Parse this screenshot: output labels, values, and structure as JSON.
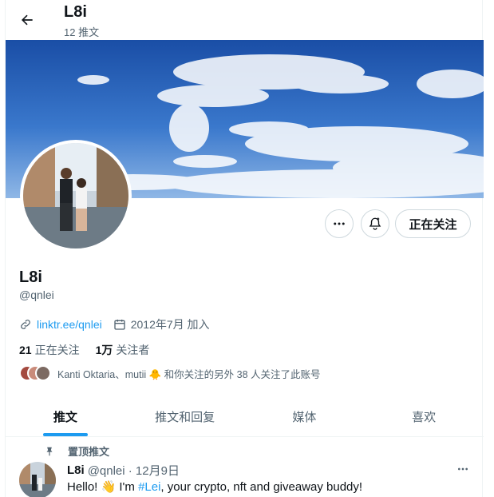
{
  "header": {
    "title": "L8i",
    "subtitle": "12 推文"
  },
  "profile": {
    "display_name": "L8i",
    "handle": "@qnlei",
    "link": "linktr.ee/qnlei",
    "joined": "2012年7月 加入",
    "following_count": "21",
    "following_label": "正在关注",
    "followers_count": "1万",
    "followers_label": "关注者",
    "followed_by_text": "Kanti Oktaria、mutii 🐥 和你关注的另外 38 人关注了此账号",
    "follow_button_label": "正在关注"
  },
  "tabs": [
    {
      "label": "推文",
      "active": true
    },
    {
      "label": "推文和回复",
      "active": false
    },
    {
      "label": "媒体",
      "active": false
    },
    {
      "label": "喜欢",
      "active": false
    }
  ],
  "pinned_tweet": {
    "pinned_label": "置顶推文",
    "author": "L8i",
    "meta": "@qnlei · 12月9日",
    "text_before": "Hello! 👋 I'm ",
    "hashtag": "#Lei",
    "text_after": ", your crypto, nft and giveaway buddy!"
  },
  "colors": {
    "accent": "#1d9bf0",
    "text": "#0f1419",
    "secondary_text": "#536471"
  },
  "icons": [
    "back-arrow-icon",
    "more-icon",
    "bell-plus-icon",
    "link-icon",
    "calendar-icon",
    "pin-icon"
  ]
}
